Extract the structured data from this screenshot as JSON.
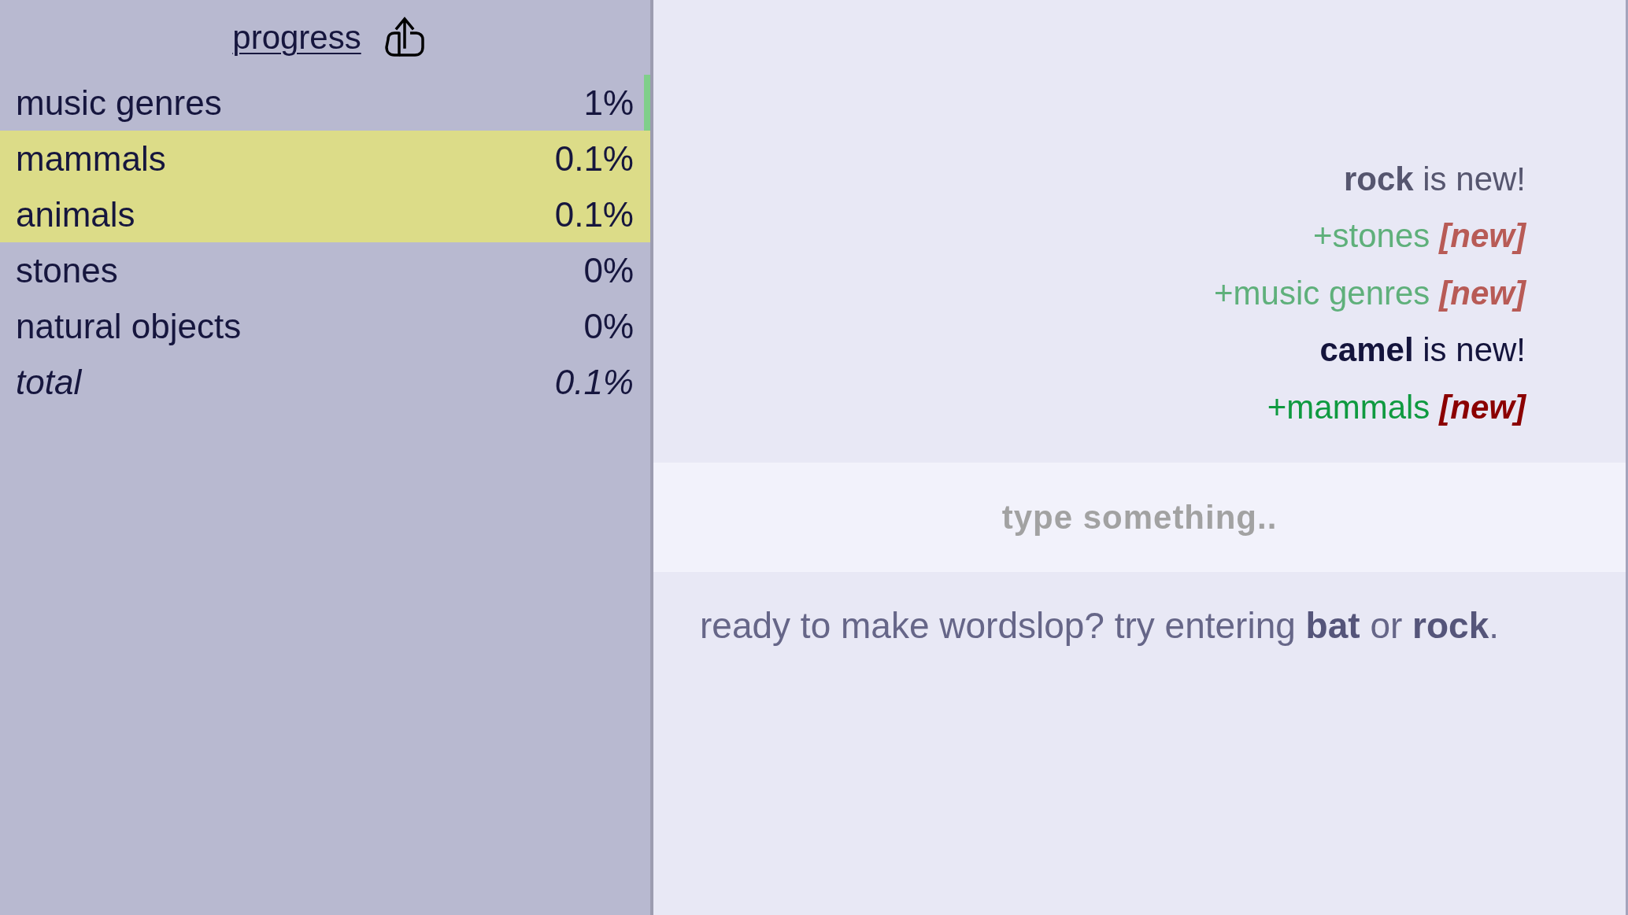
{
  "progress": {
    "title": "progress",
    "rows": [
      {
        "label": "music genres",
        "value": "1%",
        "highlighted": false,
        "updated": true
      },
      {
        "label": "mammals",
        "value": "0.1%",
        "highlighted": true,
        "updated": false
      },
      {
        "label": "animals",
        "value": "0.1%",
        "highlighted": true,
        "updated": false
      },
      {
        "label": "stones",
        "value": "0%",
        "highlighted": false,
        "updated": false
      },
      {
        "label": "natural objects",
        "value": "0%",
        "highlighted": false,
        "updated": false
      }
    ],
    "total": {
      "label": "total",
      "value": "0.1%"
    }
  },
  "log": [
    {
      "kind": "announce",
      "text": "**rock** is new!",
      "faded": true
    },
    {
      "kind": "gain",
      "text": "+stones",
      "tag": "[new]",
      "faded": true
    },
    {
      "kind": "gain",
      "text": "+music genres",
      "tag": "[new]",
      "faded": true
    },
    {
      "kind": "announce",
      "text": "**camel** is new!",
      "faded": false
    },
    {
      "kind": "gain",
      "text": "+mammals",
      "tag": "[new]",
      "faded": false
    }
  ],
  "input": {
    "placeholder": "type something.."
  },
  "hint": "ready to make wordslop? try entering **bat** or **rock**."
}
